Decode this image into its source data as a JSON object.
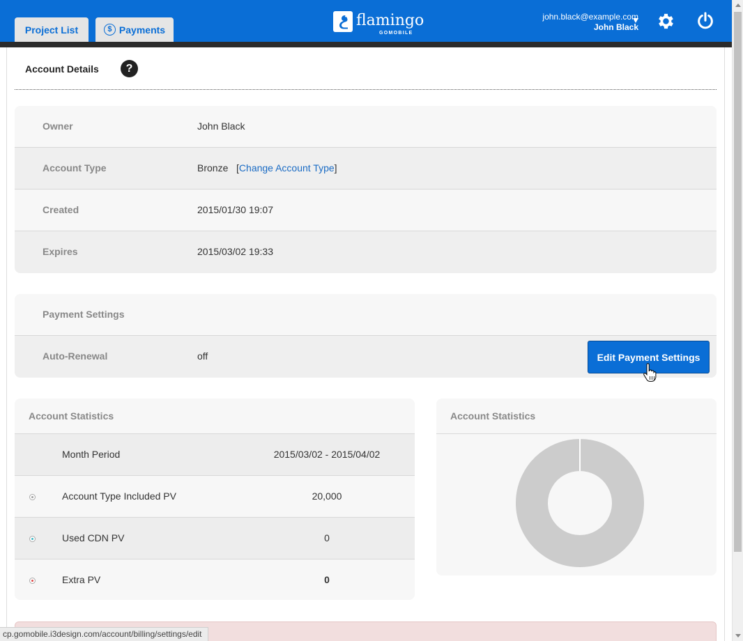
{
  "header": {
    "tabs": [
      {
        "label": "Project List"
      },
      {
        "label": "Payments",
        "icon": "dollar-coin-icon"
      }
    ],
    "logo": {
      "word": "flamingo",
      "sub": "GOMOBILE"
    },
    "user": {
      "email": "john.black@example.com",
      "name": "John Black"
    },
    "colors": {
      "brand": "#0a6ed6",
      "bar": "#2b2b2b"
    }
  },
  "section": {
    "title": "Account Details",
    "help": "?"
  },
  "account": {
    "rows": [
      {
        "label": "Owner",
        "value": "John Black"
      },
      {
        "label": "Account Type",
        "value": "Bronze",
        "link_prefix": "[",
        "link": "Change Account Type",
        "link_suffix": "]"
      },
      {
        "label": "Created",
        "value": "2015/01/30 19:07"
      },
      {
        "label": "Expires",
        "value": "2015/03/02 19:33"
      }
    ]
  },
  "payment": {
    "heading": "Payment Settings",
    "auto_renewal_label": "Auto-Renewal",
    "auto_renewal_value": "off",
    "edit_button": "Edit Payment Settings"
  },
  "stats": {
    "title": "Account Statistics",
    "rows": [
      {
        "label": "Month Period",
        "value": "2015/03/02 - 2015/04/02"
      },
      {
        "label": "Account Type Included PV",
        "value": "20,000",
        "dot_color": "#9e9e9e"
      },
      {
        "label": "Used CDN PV",
        "value": "0",
        "dot_color": "#3bb8c4"
      },
      {
        "label": "Extra PV",
        "value": "0",
        "dot_color": "#e04848"
      }
    ]
  },
  "chart_panel": {
    "title": "Account Statistics"
  },
  "chart_data": {
    "type": "pie",
    "categories": [
      "Account Type Included PV",
      "Used CDN PV",
      "Extra PV"
    ],
    "values": [
      20000,
      0,
      0
    ],
    "colors": [
      "#cccccc",
      "#3bb8c4",
      "#e04848"
    ],
    "title": ""
  },
  "statusbar": {
    "url": "cp.gomobile.i3design.com/account/billing/settings/edit"
  }
}
